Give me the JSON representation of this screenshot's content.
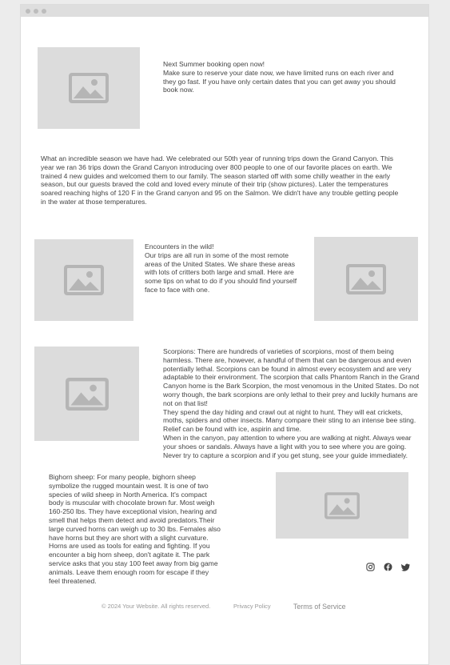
{
  "browser": {
    "controls": [
      "close-dot",
      "minimize-dot",
      "maximize-dot"
    ]
  },
  "booking": {
    "title": "Next Summer booking open now!",
    "body": "Make sure to reserve your date now, we have limited runs on each river and they go fast. If you have only certain dates that you can get away you should book now."
  },
  "season": {
    "body": "What an incredible season we have had. We celebrated our 50th year of running trips down the Grand Canyon. This year we ran 36 trips down the Grand Canyon introducing over 800 people to one of our favorite places on earth. We trained 4 new guides and welcomed them to our family. The season started off with some chilly weather in the early season, but our guests braved the cold and loved every minute of their trip (show pictures). Later the temperatures soared reaching highs of 120 F in the Grand canyon and 95 on the Salmon. We didn't have any trouble getting people in the water at those temperatures."
  },
  "encounters": {
    "title": "Encounters in the wild!",
    "body": "Our trips are all run in some of the most remote areas of the United States. We share these areas with lots of critters both large and small. Here are some tips on what to do if you should find yourself face to face with one."
  },
  "scorpions": {
    "p1": "Scorpions: There are hundreds of varieties of scorpions, most of them being harmless. There are, however, a handful of them that can be dangerous and even potentially lethal. Scorpions can be found in almost every ecosystem and are very adaptable to their environment. The scorpion that calls Phantom Ranch in the Grand Canyon home is the Bark Scorpion, the most venomous in the United States. Do not worry though, the bark scorpions are only lethal to their prey and luckily humans are not on that list!",
    "p2": "They spend the day hiding and crawl out at night to hunt. They will eat crickets, moths, spiders and other insects. Many compare their sting to an intense bee sting. Relief can be found with ice, aspirin and time.",
    "p3": "When in the canyon, pay attention to where you are walking at night. Always wear your shoes or sandals. Always have a light with you to see where you are going. Never try to capture a scorpion and if you get stung, see your guide immediately."
  },
  "bighorn": {
    "body": "Bighorn sheep: For many people, bighorn sheep symbolize the rugged mountain west. It is one of two species of wild sheep in North America. It's compact body is muscular with chocolate brown fur. Most weigh 160-250 lbs. They have exceptional vision, hearing and smell that helps them detect and avoid predators.Their large curved horns can weigh up to 30 lbs. Females also have horns but they are short with a slight curvature. Horns are used as tools for eating and fighting. If you encounter a big horn sheep, don't agitate it. The park service asks that you stay 100 feet away from big game animals. Leave them enough room for escape if they feel threatened."
  },
  "footer": {
    "copyright": "© 2024 Your Website. All rights reserved.",
    "privacy": "Privacy Policy",
    "terms": "Terms of Service"
  },
  "social": [
    "instagram-icon",
    "facebook-icon",
    "twitter-icon"
  ],
  "colors": {
    "placeholder_bg": "#dcdcdc",
    "placeholder_icon": "#b5b5b5",
    "window_bg": "#ffffff",
    "page_bg": "#ececec"
  }
}
